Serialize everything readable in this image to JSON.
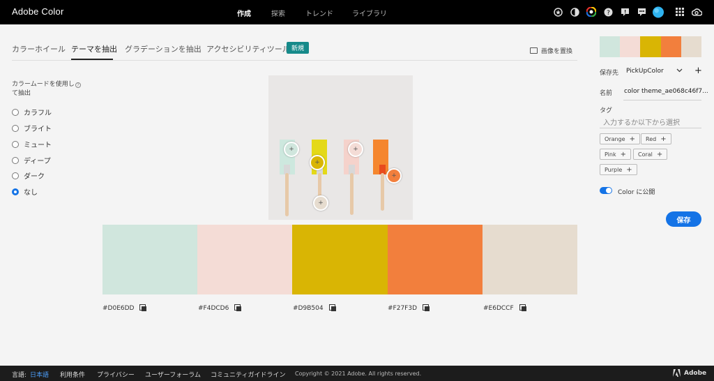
{
  "app": {
    "title": "Adobe Color"
  },
  "nav": {
    "items": [
      "作成",
      "探索",
      "トレンド",
      "ライブラリ"
    ],
    "active": "作成"
  },
  "header_icons": [
    "settings-icon",
    "color-theme-icon",
    "color-wheel-icon",
    "help-icon",
    "notification-icon",
    "feedback-icon",
    "avatar",
    "apps-grid-icon",
    "creative-cloud-icon"
  ],
  "tabs": {
    "items": [
      "カラーホイール",
      "テーマを抽出",
      "グラデーションを抽出",
      "アクセシビリティツール"
    ],
    "active": "テーマを抽出",
    "badge": "新規",
    "replace_image": "画像を置換"
  },
  "color_mood": {
    "label": "カラームードを使用して抽出",
    "help": "?",
    "options": [
      "カラフル",
      "ブライト",
      "ミュート",
      "ディープ",
      "ダーク",
      "なし"
    ],
    "selected": "なし"
  },
  "picker_marks": [
    "+",
    "+",
    "+",
    "+",
    "+"
  ],
  "palette": [
    {
      "hex": "#D0E6DD",
      "color": "#D0E6DD"
    },
    {
      "hex": "#F4DCD6",
      "color": "#F4DCD6"
    },
    {
      "hex": "#D9B504",
      "color": "#D9B504"
    },
    {
      "hex": "#F27F3D",
      "color": "#F27F3D"
    },
    {
      "hex": "#E6DCCF",
      "color": "#E6DCCF"
    }
  ],
  "sidebar": {
    "save_to_label": "保存先",
    "library": "PickUpColor",
    "add": "+",
    "name_label": "名前",
    "name_value": "color theme_ae068c46f7...",
    "tag_label": "タグ",
    "tag_placeholder": "入力するか以下から選択",
    "tags": [
      "Orange",
      "Red",
      "Pink",
      "Coral",
      "Purple"
    ],
    "publish_label": "Color に公開",
    "publish_enabled": true,
    "save_button": "保存"
  },
  "footer": {
    "language_label": "言語:",
    "language": "日本語",
    "links": [
      "利用条件",
      "プライバシー",
      "ユーザーフォーラム",
      "コミュニティガイドライン"
    ],
    "copyright": "Copyright © 2021 Adobe. All rights reserved.",
    "brand": "Adobe"
  },
  "colors": {
    "accent": "#1473e6",
    "badge": "#168a8a",
    "topbar": "#000000",
    "footer": "#1c1c1c"
  }
}
